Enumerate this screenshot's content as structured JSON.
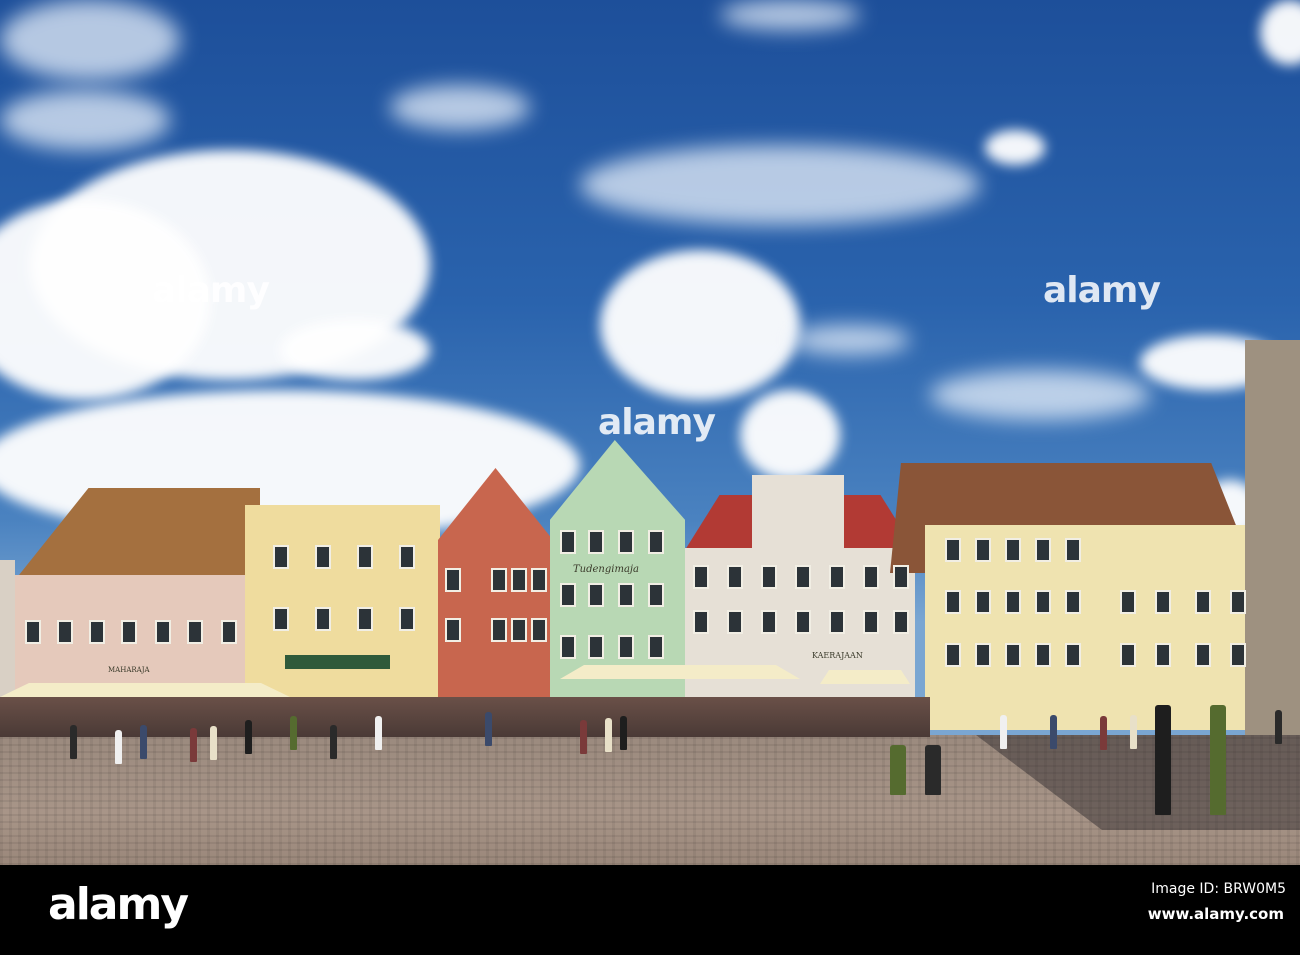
{
  "photo": {
    "watermark": "alamy",
    "signs": {
      "green_house": "Tudengimaja",
      "pink_house": "MAHARAJA",
      "white_house": "KAERAJAAN"
    }
  },
  "footer": {
    "logo": "alamy",
    "image_id": "Image ID: BRW0M5",
    "url": "www.alamy.com"
  }
}
